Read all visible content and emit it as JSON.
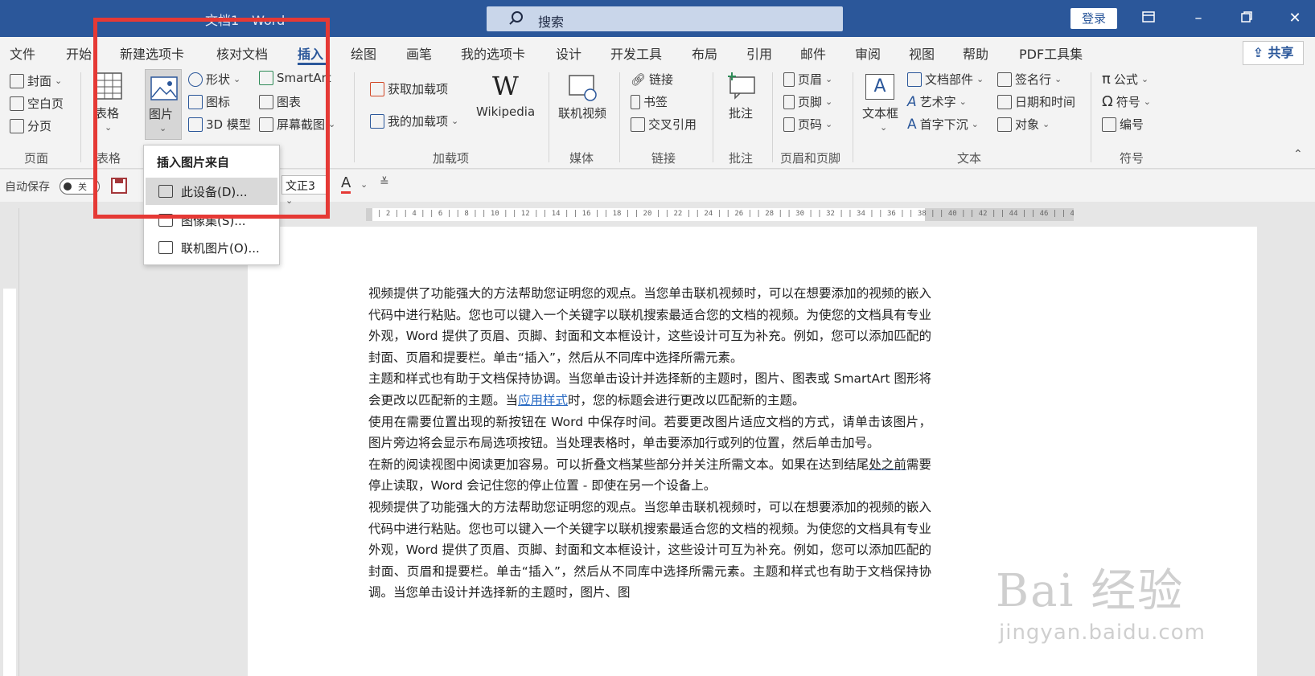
{
  "titlebar": {
    "doc_title": "文档1 - Word",
    "search_placeholder": "搜索",
    "login": "登录"
  },
  "tabs": [
    "文件",
    "开始",
    "新建选项卡",
    "核对文档",
    "插入",
    "绘图",
    "画笔",
    "我的选项卡",
    "设计",
    "开发工具",
    "布局",
    "引用",
    "邮件",
    "审阅",
    "视图",
    "帮助",
    "PDF工具集"
  ],
  "active_tab": "插入",
  "share": "共享",
  "ribbon": {
    "pages": {
      "cover": "封面",
      "blank": "空白页",
      "break": "分页",
      "label": "页面"
    },
    "table": {
      "btn": "表格",
      "label": "表格"
    },
    "illustrations": {
      "picture": "图片",
      "shapes": "形状",
      "icons": "图标",
      "model3d": "3D 模型",
      "smartart": "SmartArt",
      "chart": "图表",
      "screenshot": "屏幕截图"
    },
    "addins": {
      "get": "获取加载项",
      "mine": "我的加载项",
      "wikipedia": "Wikipedia",
      "label": "加载项"
    },
    "media": {
      "video": "联机视频",
      "label": "媒体"
    },
    "links": {
      "link": "链接",
      "bookmark": "书签",
      "xref": "交叉引用",
      "label": "链接"
    },
    "comments": {
      "comment": "批注",
      "label": "批注"
    },
    "header_footer": {
      "header": "页眉",
      "footer": "页脚",
      "pagenum": "页码",
      "label": "页眉和页脚"
    },
    "text": {
      "textbox": "文本框",
      "quickparts": "文档部件",
      "wordart": "艺术字",
      "dropcap": "首字下沉",
      "signature": "签名行",
      "datetime": "日期和时间",
      "object": "对象",
      "label": "文本"
    },
    "symbols": {
      "equation": "公式",
      "symbol": "符号",
      "number": "编号",
      "label": "符号"
    }
  },
  "qat": {
    "autosave": "自动保存",
    "toggle": "关",
    "font_box": "文正3"
  },
  "dropdown": {
    "header": "插入图片来自",
    "items": [
      "此设备(D)...",
      "图像集(S)...",
      "联机图片(O)..."
    ]
  },
  "document": {
    "p1": "视频提供了功能强大的方法帮助您证明您的观点。当您单击联机视频时，可以在想要添加的视频的嵌入代码中进行粘贴。您也可以键入一个关键字以联机搜索最适合您的文档的视频。为使您的文档具有专业外观，Word 提供了页眉、页脚、封面和文本框设计，这些设计可互为补充。例如，您可以添加匹配的封面、页眉和提要栏。单击“插入”，然后从不同库中选择所需元素。",
    "p2a": "主题和样式也有助于文档保持协调。当您单击设计并选择新的主题时，图片、图表或 SmartArt 图形将会更改以匹配新的主题。当",
    "p2_link": "应用样式",
    "p2b": "时，您的标题会进行更改以匹配新的主题。",
    "p3": "使用在需要位置出现的新按钮在 Word 中保存时间。若要更改图片适应文档的方式，请单击该图片，图片旁边将会显示布局选项按钮。当处理表格时，单击要添加行或列的位置，然后单击加号。",
    "p4a": "在新的阅读视图中阅读更加容易。可以折叠文档某些部分并关注所需文本。如果在达到结尾",
    "p4_ul": "处之前",
    "p4b": "需要停止读取，Word 会记住您的停止位置 - 即使在另一个设备上。",
    "p5": "视频提供了功能强大的方法帮助您证明您的观点。当您单击联机视频时，可以在想要添加的视频的嵌入代码中进行粘贴。您也可以键入一个关键字以联机搜索最适合您的文档的视频。为使您的文档具有专业外观，Word 提供了页眉、页脚、封面和文本框设计，这些设计可互为补充。例如，您可以添加匹配的封面、页眉和提要栏。单击“插入”，然后从不同库中选择所需元素。主题和样式也有助于文档保持协调。当您单击设计并选择新的主题时，图片、图"
  },
  "watermark": {
    "line1": "Bai 经验",
    "line2": "jingyan.baidu.com"
  },
  "colors": {
    "brand": "#2b579a",
    "highlight": "#e53935"
  }
}
